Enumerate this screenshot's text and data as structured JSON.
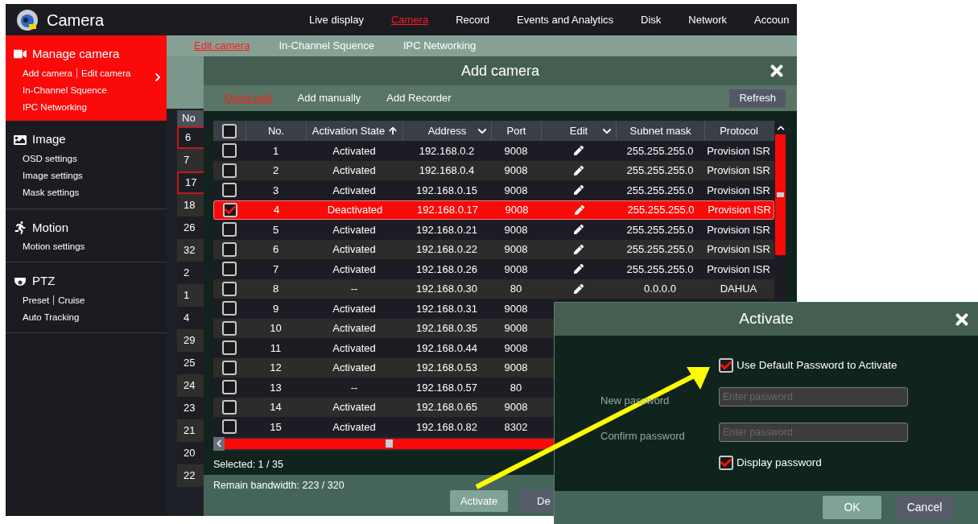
{
  "app": {
    "title": "Camera"
  },
  "top_nav": [
    {
      "label": "Live display",
      "selected": false
    },
    {
      "label": "Camera",
      "selected": true
    },
    {
      "label": "Record",
      "selected": false
    },
    {
      "label": "Events and Analytics",
      "selected": false
    },
    {
      "label": "Disk",
      "selected": false
    },
    {
      "label": "Network",
      "selected": false
    },
    {
      "label": "Accoun",
      "selected": false
    }
  ],
  "sidebar": {
    "sections": [
      {
        "kind": "camera",
        "title": "Manage camera",
        "selected": true,
        "lines": [
          [
            "Add camera",
            "Edit camera"
          ],
          [
            "In-Channel Squence"
          ],
          [
            "IPC Networking"
          ]
        ]
      },
      {
        "kind": "image",
        "title": "Image",
        "selected": false,
        "lines": [
          [
            "OSD settings"
          ],
          [
            "Image settings"
          ],
          [
            "Mask settings"
          ]
        ]
      },
      {
        "kind": "motion",
        "title": "Motion",
        "selected": false,
        "lines": [
          [
            "Motion settings"
          ]
        ]
      },
      {
        "kind": "ptz",
        "title": "PTZ",
        "selected": false,
        "lines": [
          [
            "Preset",
            "Cruise"
          ],
          [
            "Auto Tracking"
          ]
        ]
      }
    ]
  },
  "sub_tabs": [
    {
      "label": "Edit camera",
      "selected": true
    },
    {
      "label": "In-Channel Squence",
      "selected": false
    },
    {
      "label": "IPC Networking",
      "selected": false
    }
  ],
  "background_table": {
    "header": "No",
    "rows": [
      {
        "number": "6",
        "selected": true
      },
      {
        "number": "7",
        "selected": false
      },
      {
        "number": "17",
        "selected": true
      },
      {
        "number": "18",
        "selected": false
      },
      {
        "number": "26",
        "selected": false
      },
      {
        "number": "32",
        "selected": false
      },
      {
        "number": "2",
        "selected": false
      },
      {
        "number": "1",
        "selected": false
      },
      {
        "number": "4",
        "selected": false
      },
      {
        "number": "29",
        "selected": false
      },
      {
        "number": "25",
        "selected": false
      },
      {
        "number": "24",
        "selected": false
      },
      {
        "number": "23",
        "selected": false
      },
      {
        "number": "21",
        "selected": false
      },
      {
        "number": "20",
        "selected": false
      },
      {
        "number": "22",
        "selected": false
      }
    ]
  },
  "add_camera_dialog": {
    "title": "Add camera",
    "tabs": [
      {
        "label": "Quick add",
        "selected": true
      },
      {
        "label": "Add manually",
        "selected": false
      },
      {
        "label": "Add Recorder",
        "selected": false
      }
    ],
    "refresh_button": "Refresh",
    "table": {
      "all_checked": false,
      "columns": [
        {
          "label": "No.",
          "sorted": false,
          "menu": false
        },
        {
          "label": "Activation State",
          "sorted": true,
          "menu": false
        },
        {
          "label": "Address",
          "sorted": false,
          "menu": true
        },
        {
          "label": "Port",
          "sorted": false,
          "menu": false
        },
        {
          "label": "Edit",
          "sorted": false,
          "menu": true
        },
        {
          "label": "Subnet mask",
          "sorted": false,
          "menu": false
        },
        {
          "label": "Protocol",
          "sorted": false,
          "menu": false
        }
      ],
      "rows": [
        {
          "no": "1",
          "state": "Activated",
          "address": "192.168.0.2",
          "port": "9008",
          "editable": true,
          "subnet_mask": "255.255.255.0",
          "protocol": "Provision ISR",
          "checked": false,
          "selected": false
        },
        {
          "no": "2",
          "state": "Activated",
          "address": "192.168.0.4",
          "port": "9008",
          "editable": true,
          "subnet_mask": "255.255.255.0",
          "protocol": "Provision ISR",
          "checked": false,
          "selected": false
        },
        {
          "no": "3",
          "state": "Activated",
          "address": "192.168.0.15",
          "port": "9008",
          "editable": true,
          "subnet_mask": "255.255.255.0",
          "protocol": "Provision ISR",
          "checked": false,
          "selected": false
        },
        {
          "no": "4",
          "state": "Deactivated",
          "address": "192.168.0.17",
          "port": "9008",
          "editable": true,
          "subnet_mask": "255.255.255.0",
          "protocol": "Provision ISR",
          "checked": true,
          "selected": true
        },
        {
          "no": "5",
          "state": "Activated",
          "address": "192.168.0.21",
          "port": "9008",
          "editable": true,
          "subnet_mask": "255.255.255.0",
          "protocol": "Provision ISR",
          "checked": false,
          "selected": false
        },
        {
          "no": "6",
          "state": "Activated",
          "address": "192.168.0.22",
          "port": "9008",
          "editable": true,
          "subnet_mask": "255.255.255.0",
          "protocol": "Provision ISR",
          "checked": false,
          "selected": false
        },
        {
          "no": "7",
          "state": "Activated",
          "address": "192.168.0.26",
          "port": "9008",
          "editable": true,
          "subnet_mask": "255.255.255.0",
          "protocol": "Provision ISR",
          "checked": false,
          "selected": false
        },
        {
          "no": "8",
          "state": "--",
          "address": "192.168.0.30",
          "port": "80",
          "editable": true,
          "subnet_mask": "0.0.0.0",
          "protocol": "DAHUA",
          "checked": false,
          "selected": false
        },
        {
          "no": "9",
          "state": "Activated",
          "address": "192.168.0.31",
          "port": "9008",
          "checked": false,
          "selected": false
        },
        {
          "no": "10",
          "state": "Activated",
          "address": "192.168.0.35",
          "port": "9008",
          "checked": false,
          "selected": false
        },
        {
          "no": "11",
          "state": "Activated",
          "address": "192.168.0.44",
          "port": "9008",
          "checked": false,
          "selected": false
        },
        {
          "no": "12",
          "state": "Activated",
          "address": "192.168.0.53",
          "port": "9008",
          "checked": false,
          "selected": false
        },
        {
          "no": "13",
          "state": "--",
          "address": "192.168.0.57",
          "port": "80",
          "checked": false,
          "selected": false
        },
        {
          "no": "14",
          "state": "Activated",
          "address": "192.168.0.65",
          "port": "9008",
          "checked": false,
          "selected": false
        },
        {
          "no": "15",
          "state": "Activated",
          "address": "192.168.0.82",
          "port": "8302",
          "checked": false,
          "selected": false
        }
      ]
    },
    "selected_count": "Selected: 1 / 35",
    "bandwidth": "Remain bandwidth: 223 / 320",
    "buttons": [
      {
        "label": "Activate",
        "kind": "primary"
      },
      {
        "label": "De",
        "kind": "secondary"
      }
    ]
  },
  "activate_dialog": {
    "title": "Activate",
    "default_password": {
      "label": "Use Default Password to Activate",
      "checked": true
    },
    "fields": [
      {
        "label": "New password",
        "placeholder": "Enter password",
        "disabled": true
      },
      {
        "label": "Confirm password",
        "placeholder": "Enter password",
        "disabled": true
      }
    ],
    "display_password": {
      "label": "Display password",
      "checked": true
    },
    "buttons": [
      {
        "label": "OK",
        "kind": "primary"
      },
      {
        "label": "Cancel",
        "kind": "secondary"
      }
    ]
  }
}
